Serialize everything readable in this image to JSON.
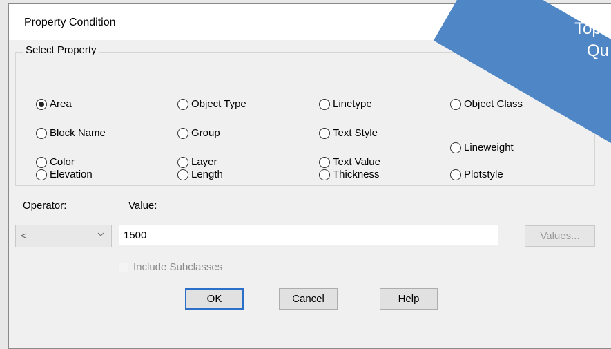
{
  "dialog": {
    "title": "Property Condition"
  },
  "select_property": {
    "label": "Select Property",
    "options": [
      {
        "label": "Area",
        "checked": true
      },
      {
        "label": "Block Name",
        "checked": false
      },
      {
        "label": "Color",
        "checked": false
      },
      {
        "label": "Elevation",
        "checked": false
      },
      {
        "label": "Object Type",
        "checked": false
      },
      {
        "label": "Group",
        "checked": false
      },
      {
        "label": "Layer",
        "checked": false
      },
      {
        "label": "Length",
        "checked": false
      },
      {
        "label": "Linetype",
        "checked": false
      },
      {
        "label": "Text Style",
        "checked": false
      },
      {
        "label": "Text Value",
        "checked": false
      },
      {
        "label": "Thickness",
        "checked": false
      },
      {
        "label": "Object Class",
        "checked": false
      },
      {
        "label": "Lineweight",
        "checked": false
      },
      {
        "label": "Plotstyle",
        "checked": false
      }
    ]
  },
  "operator": {
    "label": "Operator:",
    "value": "<"
  },
  "value": {
    "label": "Value:",
    "text": "1500",
    "values_button": "Values..."
  },
  "include_subclasses": {
    "label": "Include Subclasses",
    "checked": false,
    "enabled": false
  },
  "buttons": {
    "ok": "OK",
    "cancel": "Cancel",
    "help": "Help"
  },
  "banner": {
    "line1": "Top",
    "line2": "Qu",
    "color": "#4f86c6"
  }
}
